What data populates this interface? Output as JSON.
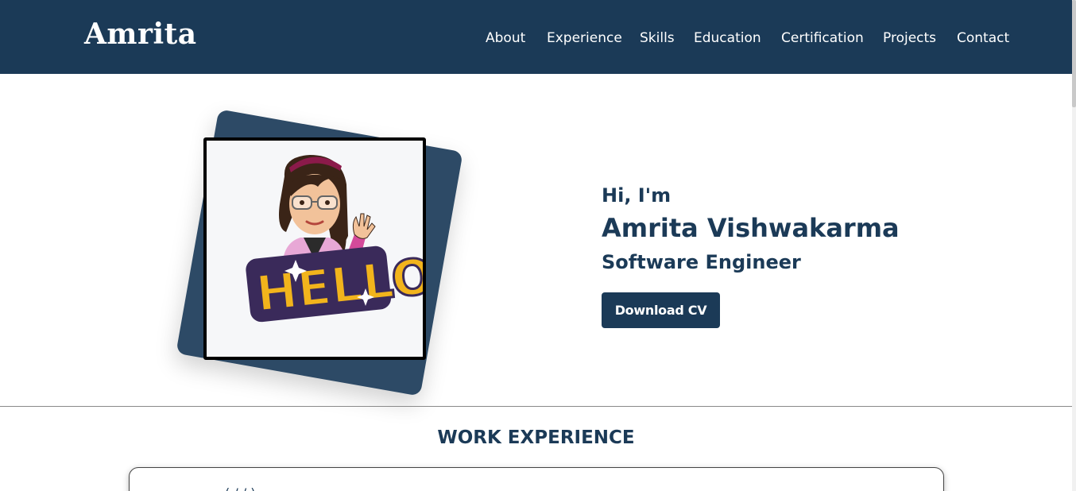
{
  "brand": {
    "name": "Amrita"
  },
  "nav": {
    "items": [
      {
        "label": "About"
      },
      {
        "label": "Experience"
      },
      {
        "label": "Skills"
      },
      {
        "label": "Education"
      },
      {
        "label": "Certification"
      },
      {
        "label": "Projects"
      },
      {
        "label": "Contact"
      }
    ]
  },
  "hero": {
    "greeting": "Hi, I'm",
    "name": "Amrita Vishwakarma",
    "role": "Software Engineer",
    "cta_label": "Download CV",
    "avatar_text": "HELLO"
  },
  "work": {
    "title": "WORK EXPERIENCE",
    "card_peek": "( / / )"
  },
  "colors": {
    "primary": "#1b3a57",
    "accent_frame": "#2d4a66",
    "background": "#ffffff"
  }
}
